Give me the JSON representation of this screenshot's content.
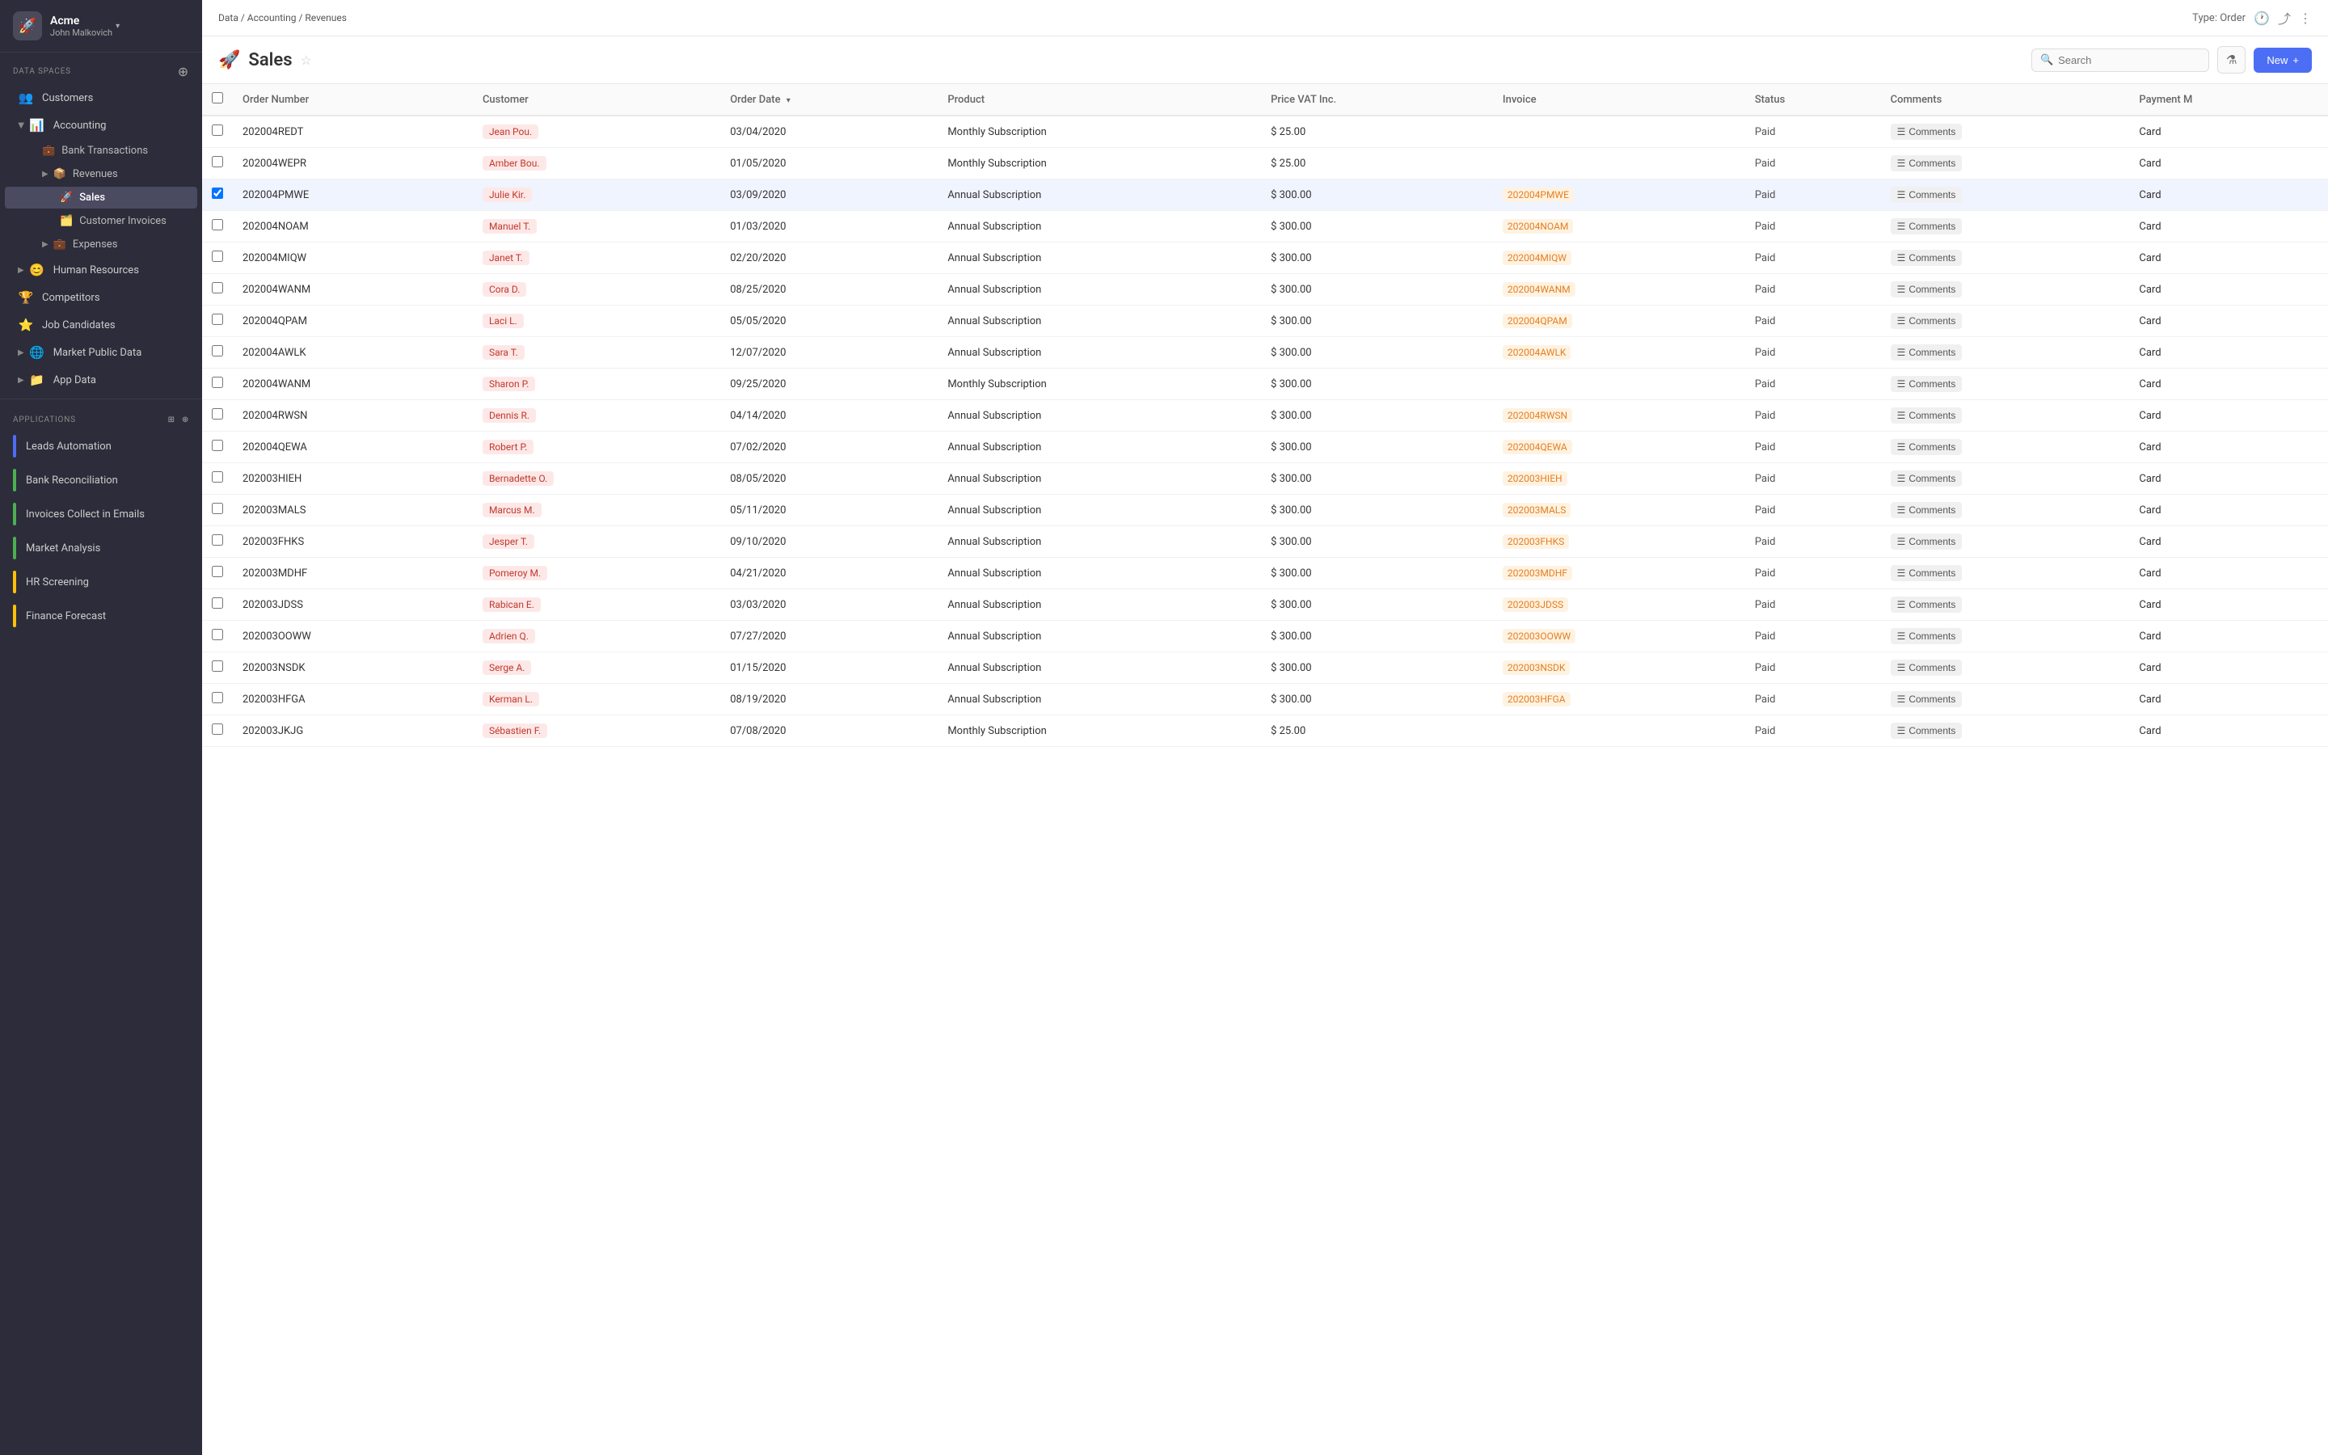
{
  "company": {
    "name": "Acme",
    "user": "John Malkovich",
    "logo_emoji": "🚀"
  },
  "sidebar": {
    "data_spaces_label": "Data Spaces",
    "items": [
      {
        "id": "customers",
        "label": "Customers",
        "icon": "👥",
        "indent": 0,
        "expandable": false
      },
      {
        "id": "accounting",
        "label": "Accounting",
        "icon": "📊",
        "indent": 0,
        "expandable": true,
        "open": true
      },
      {
        "id": "bank-transactions",
        "label": "Bank Transactions",
        "icon": "💼",
        "indent": 1,
        "expandable": false
      },
      {
        "id": "revenues",
        "label": "Revenues",
        "icon": "📦",
        "indent": 1,
        "expandable": true,
        "open": true
      },
      {
        "id": "sales",
        "label": "Sales",
        "icon": "🚀",
        "indent": 2,
        "expandable": false,
        "active": true
      },
      {
        "id": "customer-invoices",
        "label": "Customer Invoices",
        "icon": "🗂️",
        "indent": 2,
        "expandable": false
      },
      {
        "id": "expenses",
        "label": "Expenses",
        "icon": "💼",
        "indent": 1,
        "expandable": true
      },
      {
        "id": "human-resources",
        "label": "Human Resources",
        "icon": "😊",
        "indent": 0,
        "expandable": true
      },
      {
        "id": "competitors",
        "label": "Competitors",
        "icon": "🏆",
        "indent": 0,
        "expandable": false
      },
      {
        "id": "job-candidates",
        "label": "Job Candidates",
        "icon": "⭐",
        "indent": 0,
        "expandable": false
      },
      {
        "id": "market-public-data",
        "label": "Market Public Data",
        "icon": "🌐",
        "indent": 0,
        "expandable": true
      },
      {
        "id": "app-data",
        "label": "App Data",
        "icon": "📁",
        "indent": 0,
        "expandable": true
      }
    ],
    "applications_label": "Applications",
    "apps": [
      {
        "id": "leads-automation",
        "label": "Leads Automation",
        "color": "#4c6ef5"
      },
      {
        "id": "bank-reconciliation",
        "label": "Bank Reconciliation",
        "color": "#4caf50"
      },
      {
        "id": "invoices-collect",
        "label": "Invoices Collect in Emails",
        "color": "#4caf50"
      },
      {
        "id": "market-analysis",
        "label": "Market Analysis",
        "color": "#4caf50"
      },
      {
        "id": "hr-screening",
        "label": "HR Screening",
        "color": "#ffc107"
      },
      {
        "id": "finance-forecast",
        "label": "Finance Forecast",
        "color": "#ffc107"
      }
    ]
  },
  "breadcrumb": {
    "parts": [
      "Data",
      "Accounting",
      "Revenues"
    ]
  },
  "topbar": {
    "type_label": "Type: Order"
  },
  "page": {
    "title": "Sales",
    "emoji": "🚀",
    "search_placeholder": "Search",
    "new_button": "New"
  },
  "table": {
    "columns": [
      "Order Number",
      "Customer",
      "Order Date",
      "Product",
      "Price VAT Inc.",
      "Invoice",
      "Status",
      "Comments",
      "Payment M"
    ],
    "rows": [
      {
        "order_number": "202004REDT",
        "customer": "Jean Pou.",
        "order_date": "03/04/2020",
        "product": "Monthly Subscription",
        "price": "$ 25.00",
        "invoice": "",
        "status": "Paid",
        "comments": "Comments",
        "payment": "Card",
        "selected": false
      },
      {
        "order_number": "202004WEPR",
        "customer": "Amber Bou.",
        "order_date": "01/05/2020",
        "product": "Monthly Subscription",
        "price": "$ 25.00",
        "invoice": "",
        "status": "Paid",
        "comments": "Comments",
        "payment": "Card",
        "selected": false
      },
      {
        "order_number": "202004PMWE",
        "customer": "Julie Kir.",
        "order_date": "03/09/2020",
        "product": "Annual Subscription",
        "price": "$ 300.00",
        "invoice": "202004PMWE",
        "status": "Paid",
        "comments": "Comments",
        "payment": "Card",
        "selected": true
      },
      {
        "order_number": "202004NOAM",
        "customer": "Manuel T.",
        "order_date": "01/03/2020",
        "product": "Annual Subscription",
        "price": "$ 300.00",
        "invoice": "202004NOAM",
        "status": "Paid",
        "comments": "Comments",
        "payment": "Card",
        "selected": false
      },
      {
        "order_number": "202004MIQW",
        "customer": "Janet T.",
        "order_date": "02/20/2020",
        "product": "Annual Subscription",
        "price": "$ 300.00",
        "invoice": "202004MIQW",
        "status": "Paid",
        "comments": "Comments",
        "payment": "Card",
        "selected": false
      },
      {
        "order_number": "202004WANM",
        "customer": "Cora D.",
        "order_date": "08/25/2020",
        "product": "Annual Subscription",
        "price": "$ 300.00",
        "invoice": "202004WANM",
        "status": "Paid",
        "comments": "Comments",
        "payment": "Card",
        "selected": false
      },
      {
        "order_number": "202004QPAM",
        "customer": "Laci L.",
        "order_date": "05/05/2020",
        "product": "Annual Subscription",
        "price": "$ 300.00",
        "invoice": "202004QPAM",
        "status": "Paid",
        "comments": "Comments",
        "payment": "Card",
        "selected": false
      },
      {
        "order_number": "202004AWLK",
        "customer": "Sara T.",
        "order_date": "12/07/2020",
        "product": "Annual Subscription",
        "price": "$ 300.00",
        "invoice": "202004AWLK",
        "status": "Paid",
        "comments": "Comments",
        "payment": "Card",
        "selected": false
      },
      {
        "order_number": "202004WANM",
        "customer": "Sharon P.",
        "order_date": "09/25/2020",
        "product": "Monthly Subscription",
        "price": "$ 300.00",
        "invoice": "",
        "status": "Paid",
        "comments": "Comments",
        "payment": "Card",
        "selected": false
      },
      {
        "order_number": "202004RWSN",
        "customer": "Dennis R.",
        "order_date": "04/14/2020",
        "product": "Annual Subscription",
        "price": "$ 300.00",
        "invoice": "202004RWSN",
        "status": "Paid",
        "comments": "Comments",
        "payment": "Card",
        "selected": false
      },
      {
        "order_number": "202004QEWA",
        "customer": "Robert P.",
        "order_date": "07/02/2020",
        "product": "Annual Subscription",
        "price": "$ 300.00",
        "invoice": "202004QEWA",
        "status": "Paid",
        "comments": "Comments",
        "payment": "Card",
        "selected": false
      },
      {
        "order_number": "202003HIEH",
        "customer": "Bernadette O.",
        "order_date": "08/05/2020",
        "product": "Annual Subscription",
        "price": "$ 300.00",
        "invoice": "202003HIEH",
        "status": "Paid",
        "comments": "Comments",
        "payment": "Card",
        "selected": false
      },
      {
        "order_number": "202003MALS",
        "customer": "Marcus M.",
        "order_date": "05/11/2020",
        "product": "Annual Subscription",
        "price": "$ 300.00",
        "invoice": "202003MALS",
        "status": "Paid",
        "comments": "Comments",
        "payment": "Card",
        "selected": false
      },
      {
        "order_number": "202003FHKS",
        "customer": "Jesper T.",
        "order_date": "09/10/2020",
        "product": "Annual Subscription",
        "price": "$ 300.00",
        "invoice": "202003FHKS",
        "status": "Paid",
        "comments": "Comments",
        "payment": "Card",
        "selected": false
      },
      {
        "order_number": "202003MDHF",
        "customer": "Pomeroy M.",
        "order_date": "04/21/2020",
        "product": "Annual Subscription",
        "price": "$ 300.00",
        "invoice": "202003MDHF",
        "status": "Paid",
        "comments": "Comments",
        "payment": "Card",
        "selected": false
      },
      {
        "order_number": "202003JDSS",
        "customer": "Rabican E.",
        "order_date": "03/03/2020",
        "product": "Annual Subscription",
        "price": "$ 300.00",
        "invoice": "202003JDSS",
        "status": "Paid",
        "comments": "Comments",
        "payment": "Card",
        "selected": false
      },
      {
        "order_number": "202003OOWW",
        "customer": "Adrien Q.",
        "order_date": "07/27/2020",
        "product": "Annual Subscription",
        "price": "$ 300.00",
        "invoice": "202003OOWW",
        "status": "Paid",
        "comments": "Comments",
        "payment": "Card",
        "selected": false
      },
      {
        "order_number": "202003NSDK",
        "customer": "Serge A.",
        "order_date": "01/15/2020",
        "product": "Annual Subscription",
        "price": "$ 300.00",
        "invoice": "202003NSDK",
        "status": "Paid",
        "comments": "Comments",
        "payment": "Card",
        "selected": false
      },
      {
        "order_number": "202003HFGA",
        "customer": "Kerman L.",
        "order_date": "08/19/2020",
        "product": "Annual Subscription",
        "price": "$ 300.00",
        "invoice": "202003HFGA",
        "status": "Paid",
        "comments": "Comments",
        "payment": "Card",
        "selected": false
      },
      {
        "order_number": "202003JKJG",
        "customer": "Sébastien F.",
        "order_date": "07/08/2020",
        "product": "Monthly Subscription",
        "price": "$ 25.00",
        "invoice": "",
        "status": "Paid",
        "comments": "Comments",
        "payment": "Card",
        "selected": false
      }
    ]
  }
}
